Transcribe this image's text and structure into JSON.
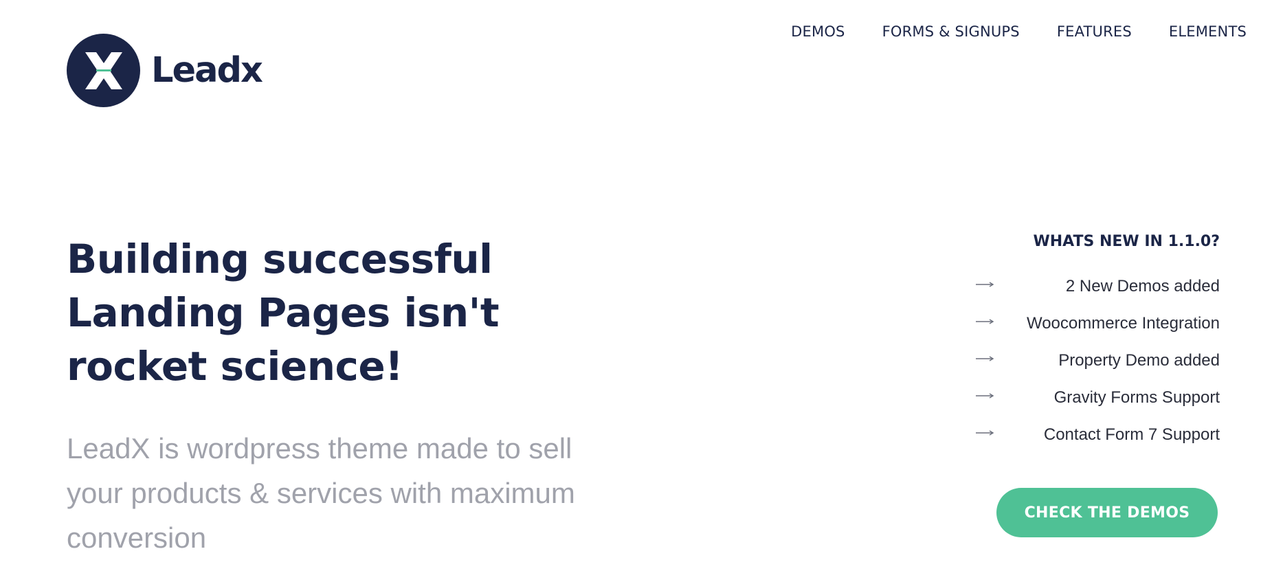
{
  "brand": {
    "name": "Leadx",
    "logo_letter": "X",
    "primary_color": "#1b2547",
    "accent_color": "#4fc195",
    "muted_text_color": "#a0a2ab"
  },
  "nav": {
    "items": [
      {
        "label": "DEMOS"
      },
      {
        "label": "FORMS & SIGNUPS"
      },
      {
        "label": "FEATURES"
      },
      {
        "label": "ELEMENTS"
      }
    ]
  },
  "hero": {
    "title_lines": [
      "Building successful",
      "Landing Pages isn't",
      "rocket science!"
    ],
    "subtitle_lines": [
      "LeadX is wordpress theme made to sell",
      "your products & services with maximum",
      "conversion"
    ]
  },
  "whats_new": {
    "heading": "WHATS NEW IN 1.1.0?",
    "arrow_icon": "long-arrow-right-icon",
    "items": [
      {
        "label": "2 New Demos added"
      },
      {
        "label": "Woocommerce Integration"
      },
      {
        "label": "Property Demo added"
      },
      {
        "label": "Gravity Forms Support"
      },
      {
        "label": "Contact Form 7 Support"
      }
    ]
  },
  "cta": {
    "label": "CHECK THE DEMOS"
  }
}
